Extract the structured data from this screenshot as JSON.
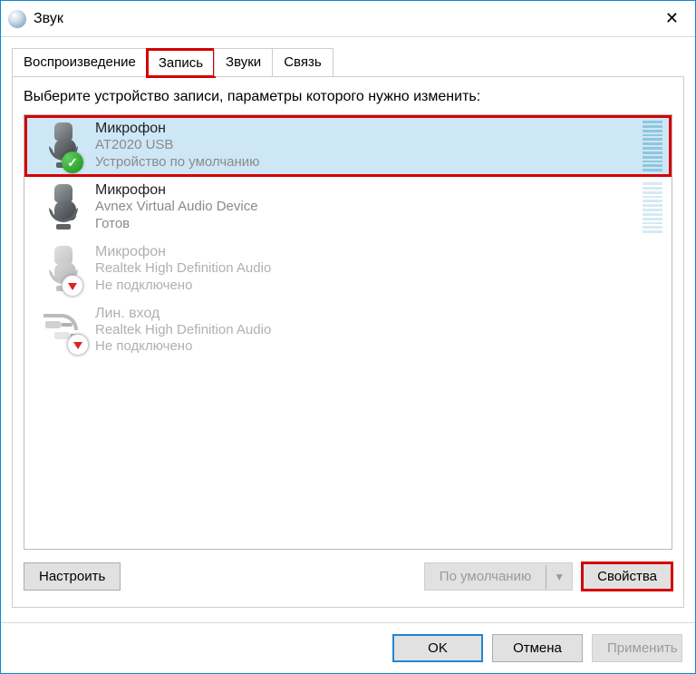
{
  "window": {
    "title": "Звук"
  },
  "tabs": [
    {
      "label": "Воспроизведение",
      "active": false
    },
    {
      "label": "Запись",
      "active": true,
      "highlight": true
    },
    {
      "label": "Звуки",
      "active": false
    },
    {
      "label": "Связь",
      "active": false
    }
  ],
  "instruction": "Выберите устройство записи, параметры которого нужно изменить:",
  "devices": [
    {
      "name": "Микрофон",
      "subtitle": "AT2020 USB",
      "status": "Устройство по умолчанию",
      "icon": "mic-dark",
      "overlay": "check",
      "selected": true,
      "highlight": true,
      "meter": true,
      "disabled": false
    },
    {
      "name": "Микрофон",
      "subtitle": "Avnex Virtual Audio Device",
      "status": "Готов",
      "icon": "mic-dark",
      "overlay": null,
      "selected": false,
      "highlight": false,
      "meter": true,
      "disabled": false
    },
    {
      "name": "Микрофон",
      "subtitle": "Realtek High Definition Audio",
      "status": "Не подключено",
      "icon": "mic-light",
      "overlay": "down",
      "selected": false,
      "highlight": false,
      "meter": false,
      "disabled": true
    },
    {
      "name": "Лин. вход",
      "subtitle": "Realtek High Definition Audio",
      "status": "Не подключено",
      "icon": "line-in",
      "overlay": "down",
      "selected": false,
      "highlight": false,
      "meter": false,
      "disabled": true
    }
  ],
  "buttons": {
    "configure": "Настроить",
    "default": "По умолчанию",
    "properties": "Свойства"
  },
  "footer": {
    "ok": "OK",
    "cancel": "Отмена",
    "apply": "Применить"
  }
}
